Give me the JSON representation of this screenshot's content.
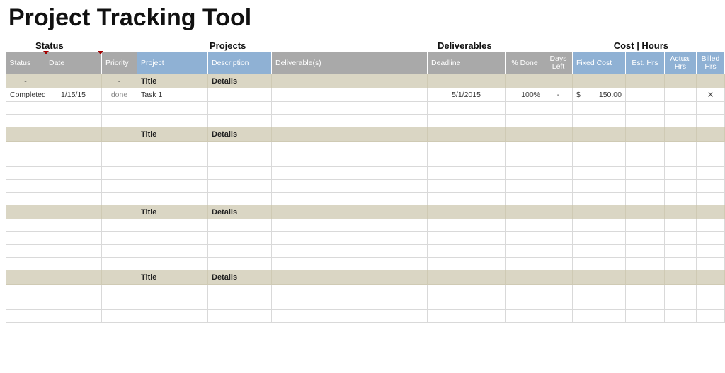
{
  "title": "Project Tracking Tool",
  "group_labels": {
    "status": "Status",
    "projects": "Projects",
    "deliverables": "Deliverables",
    "cost_hours": "Cost | Hours"
  },
  "columns": {
    "status": "Status",
    "date": "Date",
    "priority": "Priority",
    "project": "Project",
    "description": "Description",
    "deliverables": "Deliverable(s)",
    "deadline": "Deadline",
    "pct_done": "% Done",
    "days_left": "Days Left",
    "fixed_cost": "Fixed Cost",
    "est_hrs": "Est. Hrs",
    "actual_hrs": "Actual Hrs",
    "billed_hrs": "Billed Hrs"
  },
  "section": {
    "title": "Title",
    "details": "Details",
    "dash": "-"
  },
  "row1": {
    "status": "Completed",
    "date": "1/15/15",
    "priority": "done",
    "project": "Task 1",
    "deadline": "5/1/2015",
    "pct_done": "100%",
    "days_left": "-",
    "fixed_cost_sym": "$",
    "fixed_cost_val": "150.00",
    "billed_hrs": "X"
  }
}
